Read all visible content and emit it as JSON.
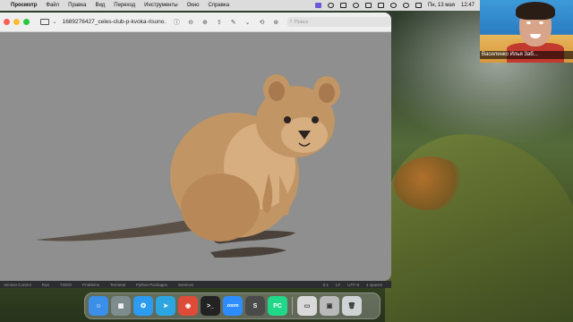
{
  "menubar": {
    "app": "Просмотр",
    "items": [
      "Файл",
      "Правка",
      "Вид",
      "Переход",
      "Инструменты",
      "Окно",
      "Справка"
    ],
    "date": "Пн, 13 мая",
    "time": "12:47"
  },
  "video": {
    "caption": "Василенко Илья Заб..."
  },
  "window": {
    "title": "1689276427_celes-club-p-kvoka-risuno...",
    "search_placeholder": "Поиск",
    "colors": {
      "traffic_close": "#ff5f57",
      "traffic_min": "#febc2e",
      "traffic_max": "#28c840",
      "canvas_bg": "#8e8f8e"
    }
  },
  "image": {
    "subject": "quokka illustration",
    "colors": {
      "fur": "#c29565",
      "fur_light": "#d6ae7f",
      "ear_inner": "#a8784e",
      "feet": "#4a423a",
      "tail": "#5a5048",
      "nose": "#2b2420"
    }
  },
  "ide": {
    "left": [
      "Version Control",
      "Run",
      "TODO",
      "Problems",
      "Terminal",
      "Python Packages",
      "Services"
    ],
    "right": [
      "8:1",
      "LF",
      "UTF-8",
      "4 spaces"
    ]
  },
  "dock": {
    "apps": [
      {
        "name": "Finder",
        "color": "#3b8fe8",
        "glyph": "☺"
      },
      {
        "name": "Launchpad",
        "color": "#7f8c8d",
        "glyph": "▦"
      },
      {
        "name": "Safari",
        "color": "#2d9bf0",
        "glyph": "✪"
      },
      {
        "name": "Telegram",
        "color": "#2ca5e0",
        "glyph": "➤"
      },
      {
        "name": "Chrome",
        "color": "#dd4b39",
        "glyph": "◉"
      },
      {
        "name": "Terminal",
        "color": "#222222",
        "glyph": ">_"
      },
      {
        "name": "Zoom",
        "color": "#2d8cff",
        "glyph": "zoom"
      },
      {
        "name": "Sublime",
        "color": "#4a4a4a",
        "glyph": "S"
      },
      {
        "name": "PyCharm",
        "color": "#21d789",
        "glyph": "PC"
      },
      {
        "name": "Preview",
        "color": "#d9d9d9",
        "glyph": "▭"
      },
      {
        "name": "Preview Doc",
        "color": "#b9b9b9",
        "glyph": "▣"
      },
      {
        "name": "Trash",
        "color": "#cfd3d6",
        "glyph": "🗑"
      }
    ]
  }
}
